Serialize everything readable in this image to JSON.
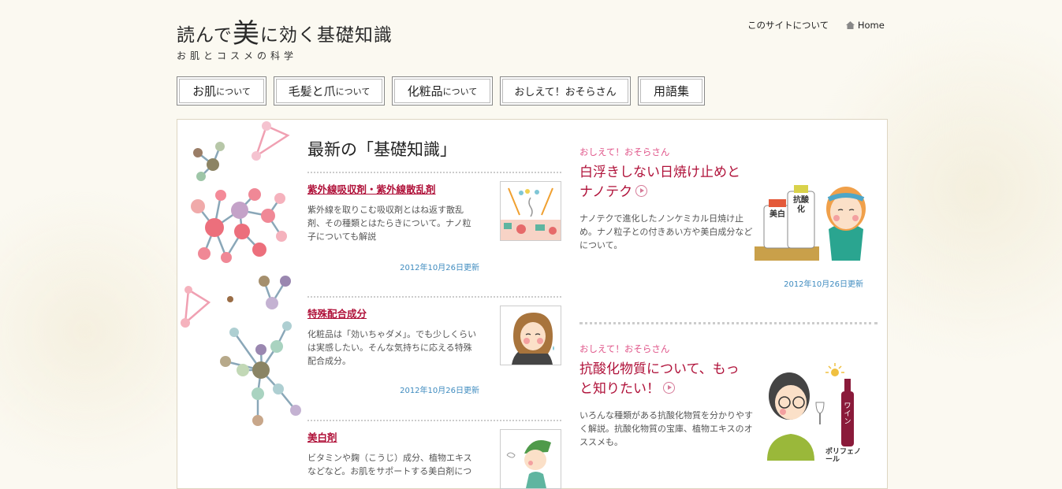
{
  "site": {
    "title_pre": "読んで",
    "title_big": "美",
    "title_post": "に効く基礎知識",
    "subtitle": "お肌とコスメの科学"
  },
  "top_links": {
    "about": "このサイトについて",
    "home": "Home"
  },
  "nav": [
    {
      "label": "お肌",
      "small": "について"
    },
    {
      "label": "毛髪と爪",
      "small": "について"
    },
    {
      "label": "化粧品",
      "small": "について"
    },
    {
      "label": "",
      "small": "おしえて！おそらさん"
    },
    {
      "label": "用語集",
      "small": ""
    }
  ],
  "latest": {
    "heading": "最新の「基礎知識」",
    "articles": [
      {
        "title": "紫外線吸収剤・紫外線散乱剤",
        "desc": "紫外線を取りこむ吸収剤とはね返す散乱剤、その種類とはたらきについて。ナノ粒子についても解説",
        "date": "2012年10月26日更新"
      },
      {
        "title": "特殊配合成分",
        "desc": "化粧品は「効いちゃダメ」。でも少しくらいは実感したい。そんな気持ちに応える特殊配合成分。",
        "date": "2012年10月26日更新"
      },
      {
        "title": "美白剤",
        "desc": "ビタミンや麹（こうじ）成分、植物エキスなどなど。お肌をサポートする美白剤につ",
        "date": ""
      }
    ]
  },
  "features": [
    {
      "category": "おしえて！おそらさん",
      "title": "白浮きしない日焼け止めとナノテク",
      "desc": "ナノテクで進化したノンケミカル日焼け止め。ナノ粒子との付きあい方や美白成分などについて。",
      "date": "2012年10月26日更新",
      "illus_labels": [
        "美白",
        "抗酸化"
      ]
    },
    {
      "category": "おしえて！おそらさん",
      "title": "抗酸化物質について、もっと知りたい！",
      "desc": "いろんな種類がある抗酸化物質を分かりやすく解説。抗酸化物質の宝庫、植物エキスのオススメも。",
      "date": "",
      "illus_labels": [
        "ワイン",
        "ポリフェノール"
      ]
    }
  ],
  "colors": {
    "accent": "#b0123a",
    "category": "#e0568a",
    "date": "#3e8bbf"
  }
}
